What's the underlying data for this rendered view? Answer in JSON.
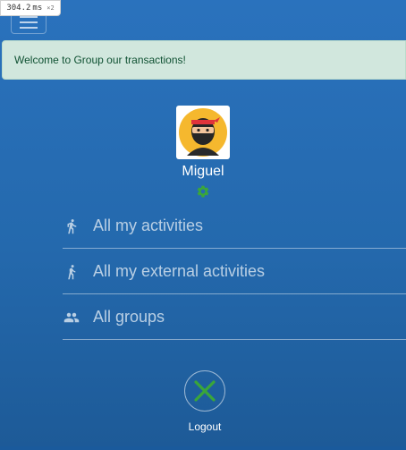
{
  "perf_badge": {
    "value": "304.2",
    "unit": "ms",
    "multiplier": "×2"
  },
  "header": {
    "menu_toggle": "hamburger-icon"
  },
  "alert": {
    "message": "Welcome to Group our transactions!"
  },
  "profile": {
    "name": "Miguel",
    "avatar": "ninja-avatar",
    "settings_icon": "gear-icon"
  },
  "menu": {
    "items": [
      {
        "label": "All my activities",
        "icon": "running-person-icon"
      },
      {
        "label": "All my external activities",
        "icon": "walking-person-icon"
      },
      {
        "label": "All groups",
        "icon": "group-icon"
      }
    ]
  },
  "logout": {
    "label": "Logout",
    "icon": "close-x-icon"
  },
  "colors": {
    "background": "#2a72bd",
    "alert_bg": "#d1e7dd",
    "alert_text": "#0f5132",
    "accent_green": "#3aa63a",
    "menu_text": "#b9cfe4"
  }
}
